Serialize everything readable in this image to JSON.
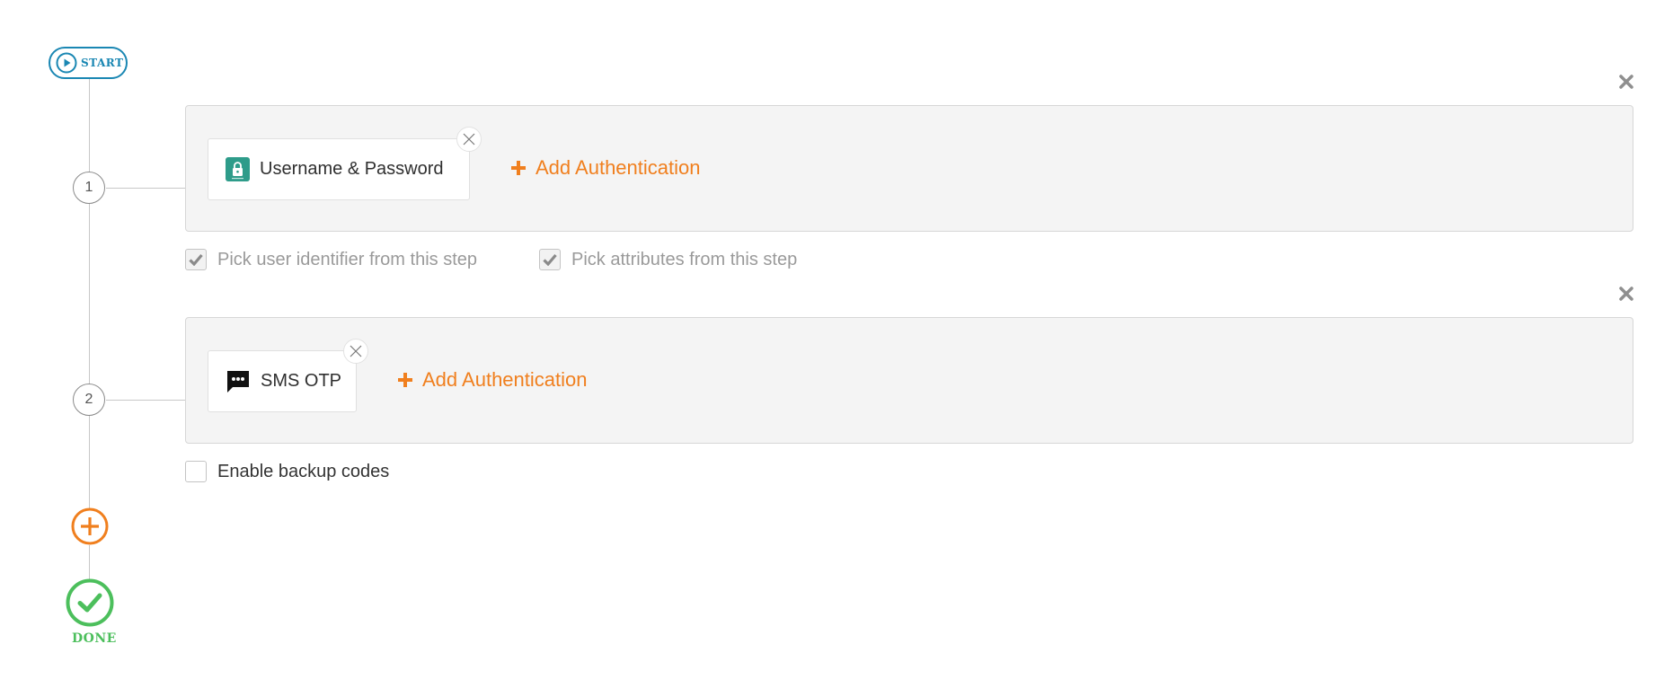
{
  "start": {
    "label": "START"
  },
  "steps": [
    {
      "number": "1",
      "authenticators": [
        {
          "label": "Username & Password",
          "icon": "lock-icon"
        }
      ],
      "add_label": "Add Authentication",
      "options": [
        {
          "label": "Pick user identifier from this step",
          "checked": true
        },
        {
          "label": "Pick attributes from this step",
          "checked": true
        }
      ]
    },
    {
      "number": "2",
      "authenticators": [
        {
          "label": "SMS OTP",
          "icon": "sms-icon"
        }
      ],
      "add_label": "Add Authentication",
      "options": [
        {
          "label": "Enable backup codes",
          "checked": false
        }
      ]
    }
  ],
  "done": {
    "label": "DONE"
  },
  "colors": {
    "accent_blue": "#1a87b3",
    "accent_orange": "#f07f1e",
    "success_green": "#4cbf5c",
    "lock_teal": "#2e9c8a"
  }
}
